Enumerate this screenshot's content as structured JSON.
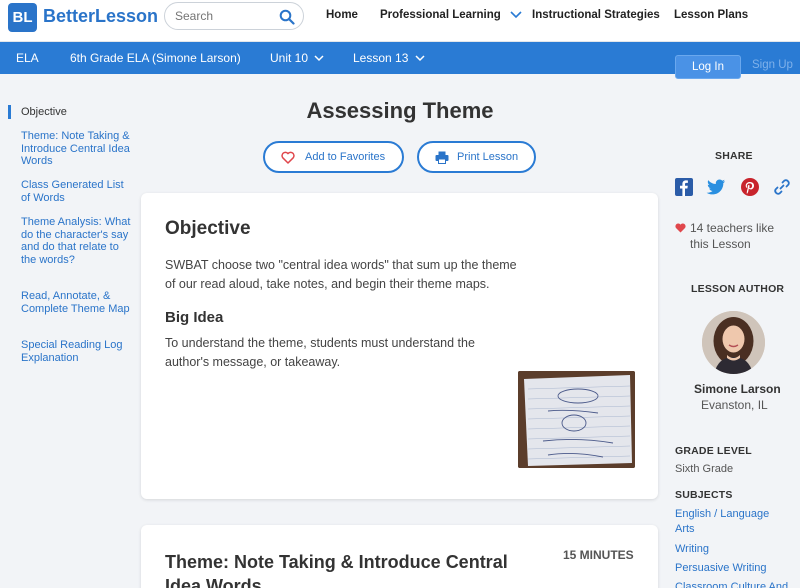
{
  "header": {
    "logo_mark": "BL",
    "logo_text": "BetterLesson",
    "search_placeholder": "Search",
    "nav": [
      "Home",
      "Professional Learning",
      "Instructional Strategies",
      "Lesson Plans"
    ]
  },
  "breadcrumb": {
    "items": [
      "ELA",
      "6th Grade ELA (Simone Larson)",
      "Unit 10",
      "Lesson 13"
    ],
    "login": "Log In",
    "signup": "Sign Up"
  },
  "sidebar": {
    "items": [
      "Objective",
      "Theme: Note Taking & Introduce Central Idea Words",
      "Class Generated List of Words",
      "Theme Analysis: What do the character's say and do that relate to the words?",
      "Read, Annotate, & Complete Theme Map",
      "Special Reading Log Explanation"
    ]
  },
  "lesson": {
    "title": "Assessing Theme",
    "add_favorites": "Add to Favorites",
    "print": "Print Lesson"
  },
  "objective_card": {
    "heading": "Objective",
    "text": "SWBAT choose two \"central idea words\" that sum up the theme of our read aloud, take notes, and begin their theme maps.",
    "big_idea_heading": "Big Idea",
    "big_idea_text": "To understand the theme, students must understand the author's message, or takeaway."
  },
  "section_card": {
    "heading": "Theme: Note Taking & Introduce Central Idea Words",
    "minutes": "15 MINUTES"
  },
  "right": {
    "share_label": "SHARE",
    "likes": "14 teachers like this Lesson",
    "author_label": "LESSON AUTHOR",
    "author_name": "Simone Larson",
    "author_location": "Evanston, IL",
    "grade_label": "GRADE LEVEL",
    "grade": "Sixth Grade",
    "subjects_label": "SUBJECTS",
    "subjects": [
      "English / Language Arts",
      "Writing",
      "Persuasive Writing",
      "Classroom Culture And"
    ]
  },
  "colors": {
    "brand": "#2a74c9",
    "bar": "#2a7bd4",
    "heart": "#e0474c"
  }
}
